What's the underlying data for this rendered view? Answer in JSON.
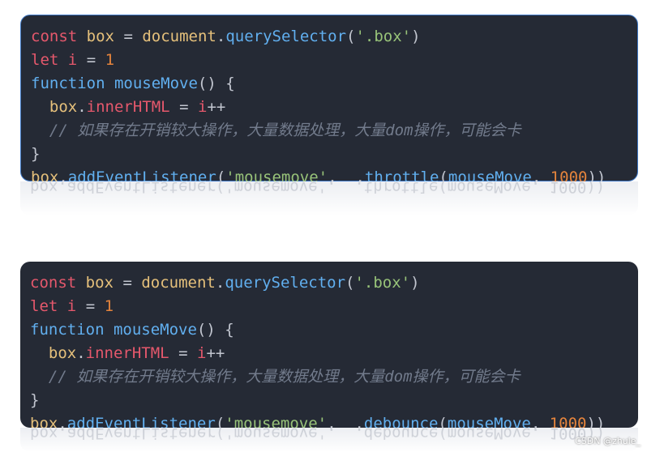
{
  "panels": [
    {
      "lines": [
        [
          "const",
          " ",
          "box",
          " ",
          "=",
          " ",
          "document",
          ".",
          "querySelector",
          "(",
          "'.box'",
          ")"
        ],
        [
          "let",
          " ",
          "i",
          " ",
          "=",
          " ",
          "1"
        ],
        [
          "function",
          " ",
          "mouseMove",
          "()",
          " ",
          "{"
        ],
        [
          "  ",
          "box",
          ".",
          "innerHTML",
          " ",
          "=",
          " ",
          "i",
          "++"
        ],
        [
          "  ",
          "// 如果存在开销较大操作，大量数据处理，大量dom操作，可能会卡"
        ],
        [
          "}"
        ],
        [
          "box",
          ".",
          "addEventListener",
          "(",
          "'mousemove'",
          ", ",
          "_",
          ".",
          "throttle",
          "(",
          "mouseMove",
          ", ",
          "1000",
          "))"
        ]
      ],
      "reflection": "box.addEventListener('mousemove', _.throttle(mouseMove, 1000))"
    },
    {
      "lines": [
        [
          "const",
          " ",
          "box",
          " ",
          "=",
          " ",
          "document",
          ".",
          "querySelector",
          "(",
          "'.box'",
          ")"
        ],
        [
          "let",
          " ",
          "i",
          " ",
          "=",
          " ",
          "1"
        ],
        [
          "function",
          " ",
          "mouseMove",
          "()",
          " ",
          "{"
        ],
        [
          "  ",
          "box",
          ".",
          "innerHTML",
          " ",
          "=",
          " ",
          "i",
          "++"
        ],
        [
          "  ",
          "// 如果存在开销较大操作，大量数据处理，大量dom操作，可能会卡"
        ],
        [
          "}"
        ],
        [
          "box",
          ".",
          "addEventListener",
          "(",
          "'mousemove'",
          ", ",
          "_",
          ".",
          "debounce",
          "(",
          "mouseMove",
          ", ",
          "1000",
          "))"
        ]
      ],
      "reflection": "box.addEventListener('mousemove', _.debounce(mouseMove, 1000))"
    }
  ],
  "watermark": "CSDN @zhule_",
  "colors": {
    "background": "#252a35",
    "keyword": "#e5586c",
    "variable": "#e5c07b",
    "function": "#61afef",
    "string": "#98c379",
    "number": "#e5843c",
    "comment": "#727b8c"
  }
}
